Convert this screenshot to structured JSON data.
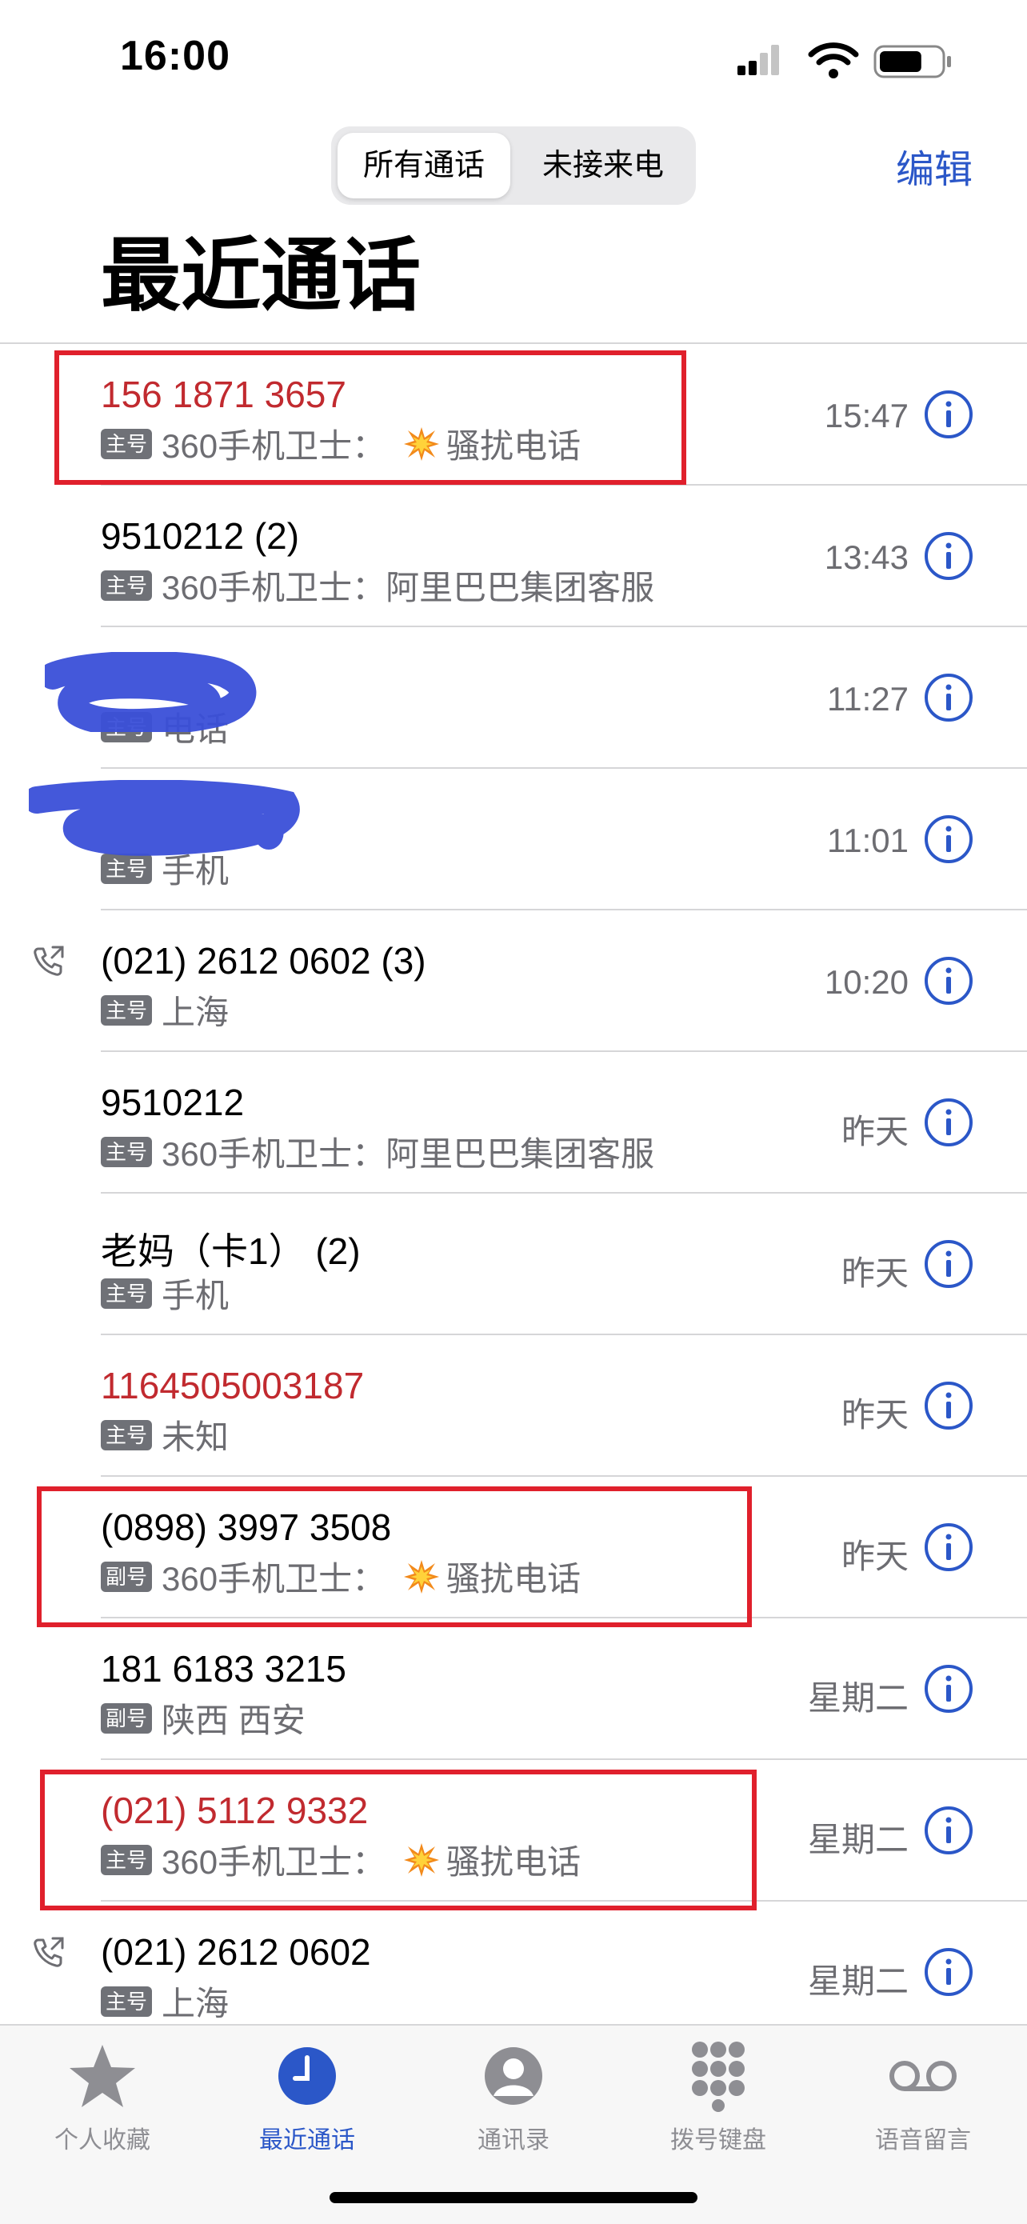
{
  "status_bar": {
    "time": "16:00",
    "battery_level": 0.7
  },
  "segments": [
    {
      "label": "所有通话",
      "selected": true
    },
    {
      "label": "未接来电",
      "selected": false
    }
  ],
  "header": {
    "edit_label": "编辑",
    "title": "最近通话"
  },
  "calls": [
    {
      "name": "156 1871 3657",
      "missed": true,
      "badge": "主号",
      "detail": "360手机卫士：",
      "spam": "骚扰电话",
      "time": "15:47",
      "outgoing": false
    },
    {
      "name": "9510212 (2)",
      "missed": false,
      "badge": "主号",
      "detail": "360手机卫士：阿里巴巴集团客服",
      "spam": "",
      "time": "13:43",
      "outgoing": false
    },
    {
      "name": "",
      "missed": false,
      "badge": "主号",
      "detail": "电话",
      "spam": "",
      "time": "11:27",
      "outgoing": false
    },
    {
      "name": "",
      "missed": false,
      "badge": "主号",
      "detail": "手机",
      "spam": "",
      "time": "11:01",
      "outgoing": false
    },
    {
      "name": "(021) 2612 0602 (3)",
      "missed": false,
      "badge": "主号",
      "detail": "上海",
      "spam": "",
      "time": "10:20",
      "outgoing": true
    },
    {
      "name": "9510212",
      "missed": false,
      "badge": "主号",
      "detail": "360手机卫士：阿里巴巴集团客服",
      "spam": "",
      "time": "昨天",
      "outgoing": false
    },
    {
      "name": "老妈（卡1） (2)",
      "missed": false,
      "badge": "主号",
      "detail": "手机",
      "spam": "",
      "time": "昨天",
      "outgoing": false
    },
    {
      "name": "1164505003187",
      "missed": true,
      "badge": "主号",
      "detail": "未知",
      "spam": "",
      "time": "昨天",
      "outgoing": false
    },
    {
      "name": "(0898) 3997 3508",
      "missed": false,
      "badge": "副号",
      "detail": "360手机卫士：",
      "spam": "骚扰电话",
      "time": "昨天",
      "outgoing": false
    },
    {
      "name": "181 6183 3215",
      "missed": false,
      "badge": "副号",
      "detail": "陕西 西安",
      "spam": "",
      "time": "星期二",
      "outgoing": false
    },
    {
      "name": "(021) 5112 9332",
      "missed": true,
      "badge": "主号",
      "detail": "360手机卫士：",
      "spam": "骚扰电话",
      "time": "星期二",
      "outgoing": false
    },
    {
      "name": "(021) 2612 0602",
      "missed": false,
      "badge": "主号",
      "detail": "上海",
      "spam": "",
      "time": "星期二",
      "outgoing": true
    }
  ],
  "tabs": [
    {
      "label": "个人收藏",
      "icon": "star-icon",
      "active": false
    },
    {
      "label": "最近通话",
      "icon": "clock-icon",
      "active": true
    },
    {
      "label": "通讯录",
      "icon": "contact-icon",
      "active": false
    },
    {
      "label": "拨号键盘",
      "icon": "keypad-icon",
      "active": false
    },
    {
      "label": "语音留言",
      "icon": "voicemail-icon",
      "active": false
    }
  ],
  "colors": {
    "accent": "#2b57c8",
    "missed": "#c12a2f",
    "annotation": "#e0202c",
    "scribble": "#3a4fd8"
  }
}
